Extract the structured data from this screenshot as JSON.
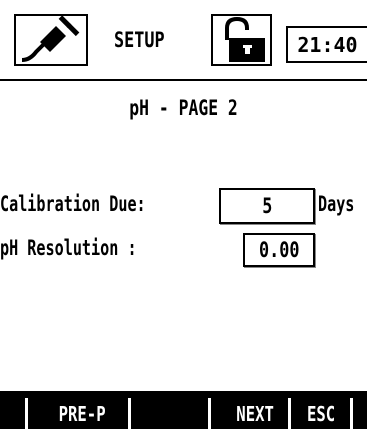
{
  "header": {
    "title": "SETUP",
    "time": "21:40",
    "icons": [
      "power-plug-icon",
      "unlocked-padlock-icon"
    ]
  },
  "page": {
    "heading": "pH - PAGE 2"
  },
  "fields": {
    "calibration_due": {
      "label": "Calibration Due:",
      "value": "5",
      "unit": "Days"
    },
    "ph_resolution": {
      "label": "pH Resolution :",
      "value": "0.00"
    }
  },
  "softkeys": {
    "key1": "",
    "key2": "PRE-P",
    "key3": "",
    "key4": "NEXT",
    "key5": "ESC"
  },
  "colors": {
    "background": "#ffffff",
    "foreground": "#000000"
  }
}
